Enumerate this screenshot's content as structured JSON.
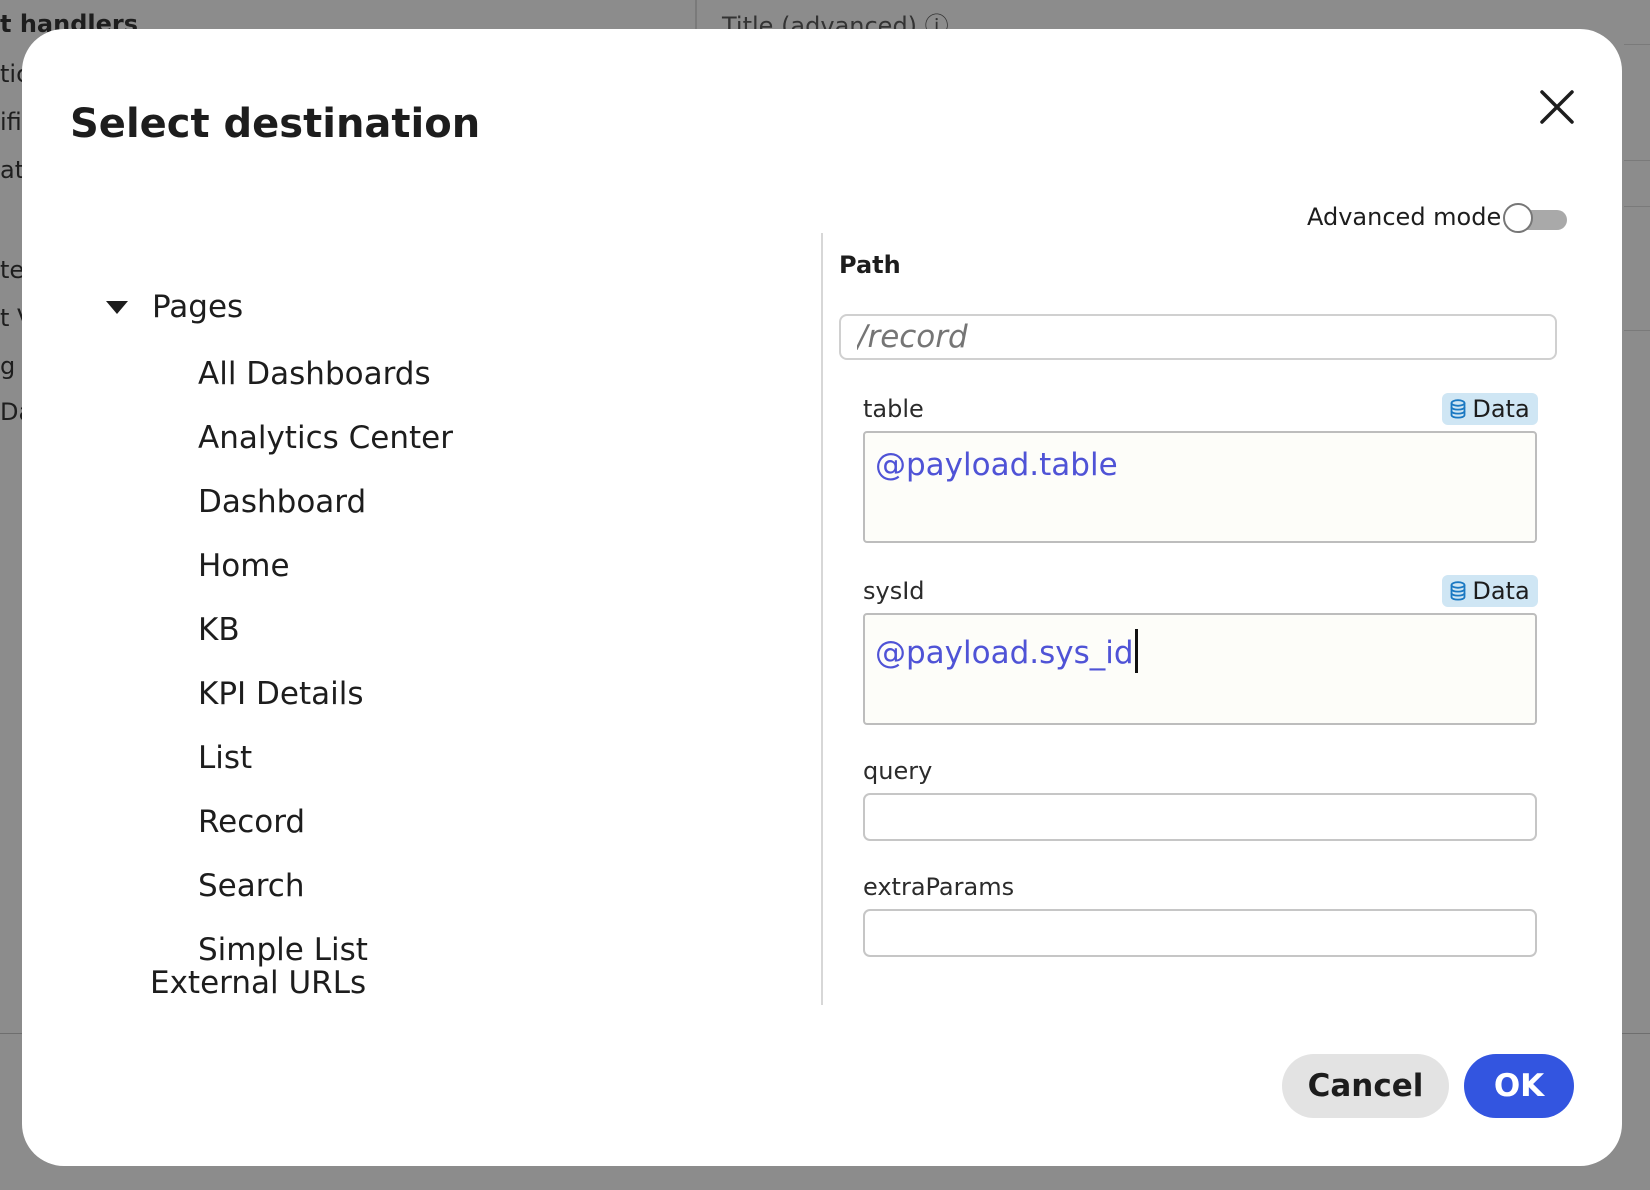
{
  "background": {
    "left_fragments": [
      "t handlers",
      "tic",
      "ifi",
      "at",
      "te",
      "t V",
      "g",
      "Da"
    ],
    "title_advanced": "Title (advanced) ⓘ"
  },
  "dialog": {
    "title": "Select destination",
    "close_icon": "close-icon"
  },
  "tree": {
    "root_label": "Pages",
    "items": [
      "All Dashboards",
      "Analytics Center",
      "Dashboard",
      "Home",
      "KB",
      "KPI Details",
      "List",
      "Record",
      "Search",
      "Simple List"
    ],
    "next_group_partial": "External URLs"
  },
  "advanced_mode": {
    "label": "Advanced mode",
    "enabled": false
  },
  "path": {
    "label": "Path",
    "placeholder": "/record"
  },
  "params": {
    "table": {
      "label": "table",
      "badge": "Data",
      "value": "@payload.table"
    },
    "sysId": {
      "label": "sysId",
      "badge": "Data",
      "value": "@payload.sys_id"
    },
    "query": {
      "label": "query",
      "value": ""
    },
    "extraParams": {
      "label": "extraParams",
      "value": ""
    }
  },
  "buttons": {
    "cancel": "Cancel",
    "ok": "OK"
  },
  "colors": {
    "accent": "#3355e0",
    "value_text": "#4f53d6",
    "badge_bg": "#cfe6f4"
  }
}
